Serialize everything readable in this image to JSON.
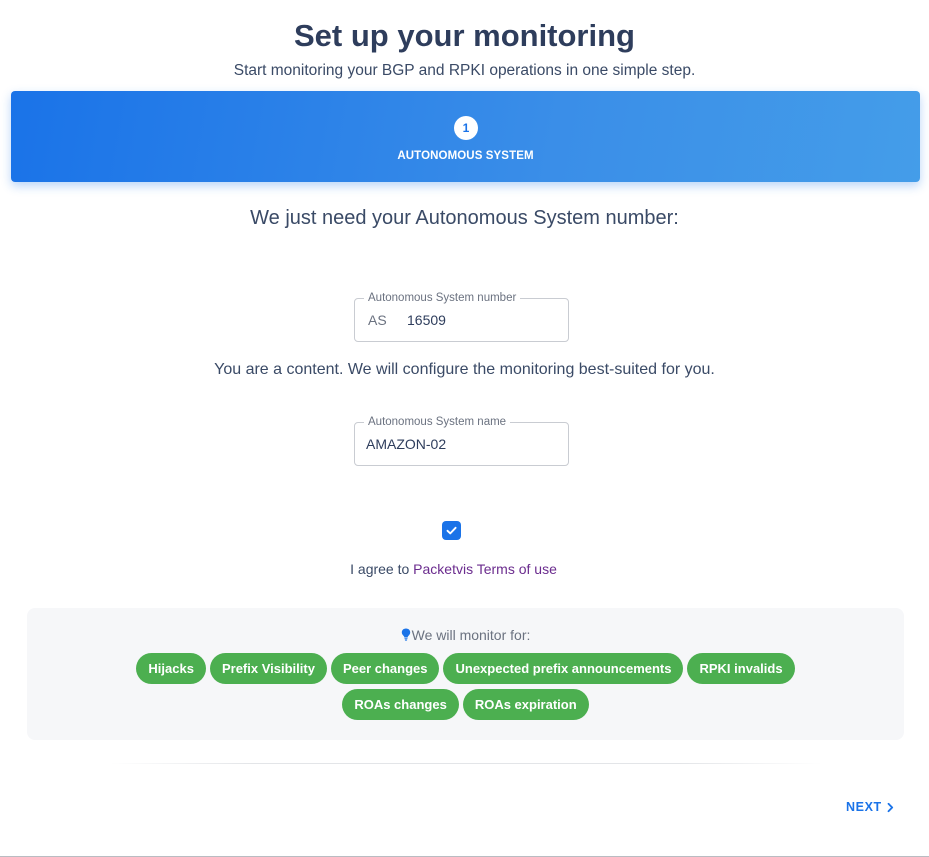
{
  "header": {
    "title": "Set up your monitoring",
    "subtitle": "Start monitoring your BGP and RPKI operations in one simple step."
  },
  "stepper": {
    "steps": [
      {
        "number": "1",
        "label": "AUTONOMOUS SYSTEM"
      }
    ]
  },
  "form": {
    "prompt": "We just need your Autonomous System number:",
    "asn_field": {
      "label": "Autonomous System number",
      "prefix": "AS",
      "value": "16509"
    },
    "content_note": "You are a content. We will configure the monitoring best-suited for you.",
    "name_field": {
      "label": "Autonomous System name",
      "value": "AMAZON-02"
    },
    "terms": {
      "checked": true,
      "text": "I agree to",
      "link": "Packetvis Terms of use"
    }
  },
  "monitor": {
    "icon": "lightbulb-icon",
    "title": "We will monitor for:",
    "items": [
      "Hijacks",
      "Prefix Visibility",
      "Peer changes",
      "Unexpected prefix announcements",
      "RPKI invalids",
      "ROAs changes",
      "ROAs expiration"
    ]
  },
  "footer": {
    "next_label": "NEXT",
    "next_icon": "chevron-right-icon"
  },
  "colors": {
    "accent": "#1a73e8",
    "chip": "#4caf50",
    "link": "#6b2c8e",
    "heading": "#2e3d5c"
  }
}
